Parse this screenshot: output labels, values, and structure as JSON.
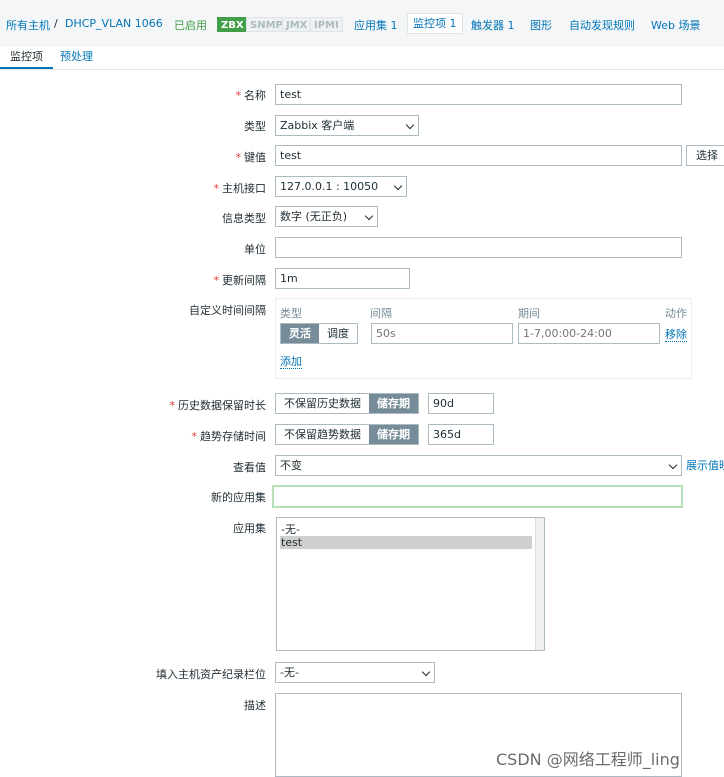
{
  "breadcrumb": {
    "all_hosts": "所有主机",
    "separator": "/",
    "host": "DHCP_VLAN 1066",
    "status": "已启用",
    "tags": [
      "ZBX",
      "SNMP",
      "JMX",
      "IPMI"
    ],
    "applications": "应用集 1",
    "items": "监控项 1",
    "triggers": "触发器 1",
    "graphs": "图形",
    "discovery": "自动发现规则",
    "web": "Web 场景"
  },
  "tabs": {
    "item": "监控项",
    "preprocessing": "预处理"
  },
  "form": {
    "name_label": "名称",
    "name_value": "test",
    "type_label": "类型",
    "type_value": "Zabbix 客户端",
    "key_label": "键值",
    "key_value": "test",
    "select_button": "选择",
    "interface_label": "主机接口",
    "interface_value": "127.0.0.1 : 10050",
    "info_type_label": "信息类型",
    "info_type_value": "数字 (无正负)",
    "units_label": "单位",
    "units_value": "",
    "update_label": "更新间隔",
    "update_value": "1m",
    "custom_label": "自定义时间间隔",
    "custom_headers": {
      "type": "类型",
      "interval": "间隔",
      "period": "期间",
      "action": "动作"
    },
    "custom_type_options": [
      "灵活",
      "调度"
    ],
    "custom_interval_placeholder": "50s",
    "custom_period_placeholder": "1-7,00:00-24:00",
    "custom_remove": "移除",
    "custom_add": "添加",
    "history_label": "历史数据保留时长",
    "history_options": [
      "不保留历史数据",
      "储存期"
    ],
    "history_value": "90d",
    "trends_label": "趋势存储时间",
    "trends_options": [
      "不保留趋势数据",
      "储存期"
    ],
    "trends_value": "365d",
    "valuemap_label": "查看值",
    "valuemap_value": "不变",
    "valuemap_link": "展示值映",
    "new_app_label": "新的应用集",
    "new_app_value": "",
    "apps_label": "应用集",
    "apps_options": [
      "-无-",
      "test"
    ],
    "inventory_label": "填入主机资产纪录栏位",
    "inventory_value": "-无-",
    "desc_label": "描述",
    "desc_value": ""
  },
  "watermark": "CSDN @网络工程师_ling",
  "colors": {
    "link": "#0275b8",
    "enabled": "#429e47",
    "required": "#e33734",
    "active_segment": "#768d99",
    "focus_border": "#b5e0b8"
  }
}
